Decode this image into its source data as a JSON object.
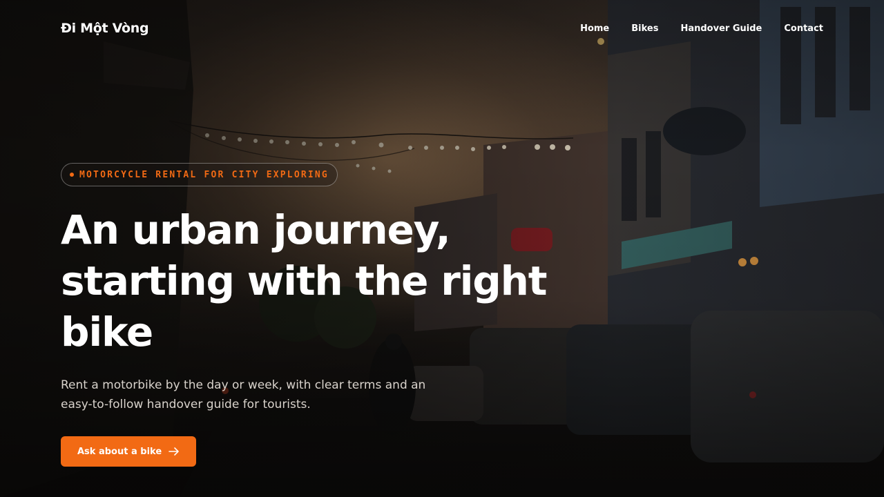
{
  "nav": {
    "brand": "Đi Một Vòng",
    "links": [
      "Home",
      "Bikes",
      "Handover Guide",
      "Contact"
    ]
  },
  "hero": {
    "eyebrow": "MOTORCYCLE RENTAL FOR CITY EXPLORING",
    "headline": "An urban journey, starting with the right bike",
    "subtitle": "Rent a motorbike by the day or week, with clear terms and an easy-to-follow handover guide for tourists.",
    "cta_label": "Ask about a bike"
  },
  "colors": {
    "accent": "#f26a14",
    "text": "#ffffff",
    "muted_text": "#d9d3cc"
  },
  "icons": {
    "cta": "arrow-right-icon",
    "eyebrow": "dot-icon"
  }
}
